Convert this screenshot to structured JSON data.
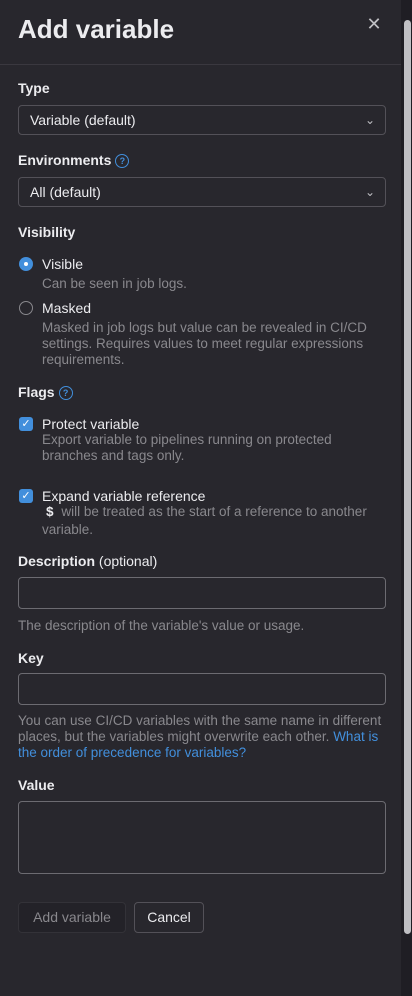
{
  "drawer": {
    "title": "Add variable",
    "close_icon": "close-icon"
  },
  "type": {
    "label": "Type",
    "selected": "Variable (default)"
  },
  "environments": {
    "label": "Environments",
    "selected": "All (default)"
  },
  "visibility": {
    "label": "Visibility",
    "options": [
      {
        "label": "Visible",
        "description": "Can be seen in job logs.",
        "checked": true
      },
      {
        "label": "Masked",
        "description": "Masked in job logs but value can be revealed in CI/CD settings. Requires values to meet regular expressions requirements.",
        "checked": false
      }
    ]
  },
  "flags": {
    "label": "Flags",
    "options": [
      {
        "label": "Protect variable",
        "description": "Export variable to pipelines running on protected branches and tags only.",
        "checked": true
      },
      {
        "label": "Expand variable reference",
        "code": "$",
        "description": " will be treated as the start of a reference to another variable.",
        "checked": true
      }
    ]
  },
  "description": {
    "label": "Description",
    "optional": " (optional)",
    "value": "",
    "help": "The description of the variable's value or usage."
  },
  "key": {
    "label": "Key",
    "value": "",
    "help": "You can use CI/CD variables with the same name in different places, but the variables might overwrite each other.",
    "help_link": "What is the order of precedence for variables?"
  },
  "value": {
    "label": "Value",
    "value": ""
  },
  "actions": {
    "submit_label": "Add variable",
    "cancel_label": "Cancel"
  },
  "colors": {
    "background": "#28272d",
    "accent": "#428fdc",
    "muted_text": "#89888d"
  }
}
